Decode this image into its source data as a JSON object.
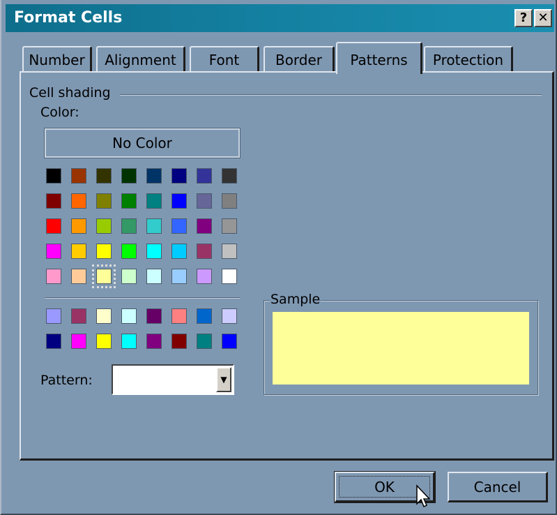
{
  "window": {
    "title": "Format Cells",
    "help_glyph": "?",
    "close_glyph": "✕"
  },
  "tabs": [
    {
      "label": "Number",
      "active": false
    },
    {
      "label": "Alignment",
      "active": false
    },
    {
      "label": "Font",
      "active": false
    },
    {
      "label": "Border",
      "active": false
    },
    {
      "label": "Patterns",
      "active": true
    },
    {
      "label": "Protection",
      "active": false
    }
  ],
  "cell_shading": {
    "group_label": "Cell shading",
    "color_label": "Color:",
    "no_color_label": "No Color",
    "palette_rows": [
      [
        "#000000",
        "#993300",
        "#333300",
        "#003300",
        "#003366",
        "#000080",
        "#333399",
        "#333333"
      ],
      [
        "#800000",
        "#ff6600",
        "#808000",
        "#008000",
        "#008080",
        "#0000ff",
        "#666699",
        "#808080"
      ],
      [
        "#ff0000",
        "#ff9900",
        "#99cc00",
        "#339966",
        "#33cccc",
        "#3366ff",
        "#800080",
        "#969696"
      ],
      [
        "#ff00ff",
        "#ffcc00",
        "#ffff00",
        "#00ff00",
        "#00ffff",
        "#00ccff",
        "#993366",
        "#c0c0c0"
      ],
      [
        "#ff99cc",
        "#ffcc99",
        "#ffff99",
        "#ccffcc",
        "#ccffff",
        "#99ccff",
        "#cc99ff",
        "#ffffff"
      ]
    ],
    "chart_rows": [
      [
        "#9999ff",
        "#993366",
        "#ffffcc",
        "#ccffff",
        "#660066",
        "#ff8080",
        "#0066cc",
        "#ccccff"
      ],
      [
        "#000080",
        "#ff00ff",
        "#ffff00",
        "#00ffff",
        "#800080",
        "#800000",
        "#008080",
        "#0000ff"
      ]
    ],
    "selected_color": "#ffff99",
    "pattern_label": "Pattern:",
    "pattern_value": ""
  },
  "sample": {
    "label": "Sample",
    "fill_color": "#ffff99"
  },
  "buttons": {
    "ok_label": "OK",
    "cancel_label": "Cancel"
  }
}
